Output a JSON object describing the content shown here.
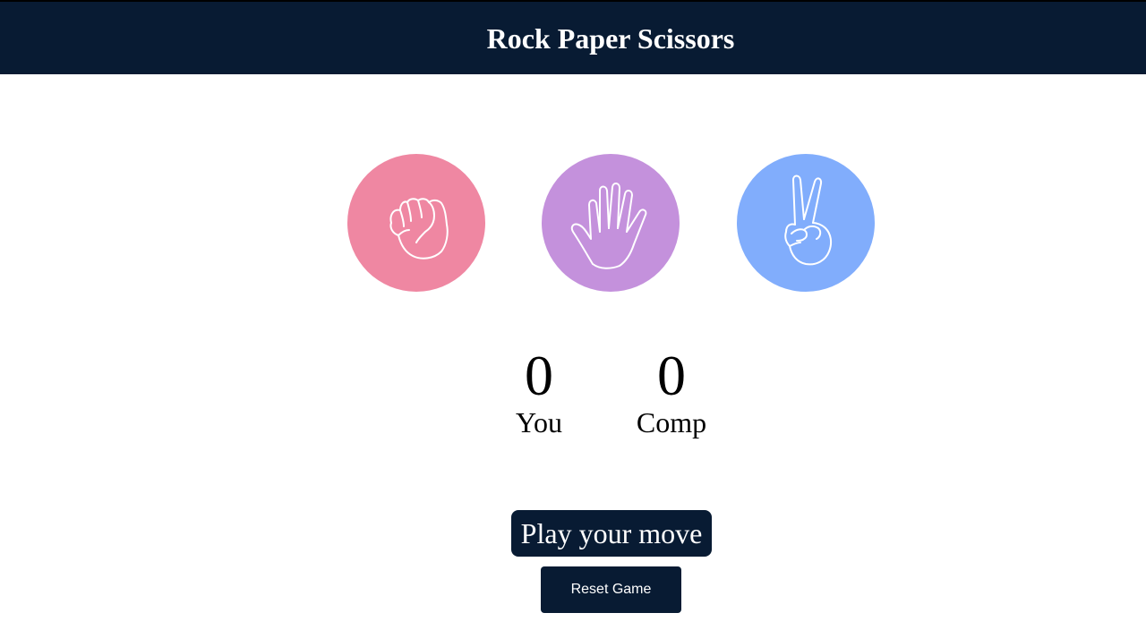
{
  "header": {
    "title": "Rock Paper Scissors"
  },
  "choices": [
    {
      "id": "rock",
      "icon": "rock-fist-icon",
      "color": "#ef87a2"
    },
    {
      "id": "paper",
      "icon": "paper-hand-icon",
      "color": "#c491dc"
    },
    {
      "id": "scissors",
      "icon": "scissors-hand-icon",
      "color": "#81adfc"
    }
  ],
  "scoreboard": {
    "user": {
      "score": "0",
      "label": "You"
    },
    "comp": {
      "score": "0",
      "label": "Comp"
    }
  },
  "message": {
    "text": "Play your move",
    "color": "#081b33"
  },
  "reset_button": {
    "label": "Reset Game"
  },
  "colors": {
    "primary": "#081b33"
  }
}
